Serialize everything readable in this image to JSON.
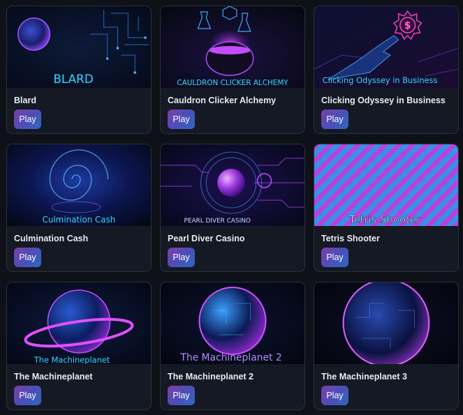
{
  "play_label": "Play",
  "games": [
    {
      "title": "Blard",
      "thumb_text": "BLARD"
    },
    {
      "title": "Cauldron Clicker Alchemy",
      "thumb_text": "CAULDRON CLICKER ALCHEMY"
    },
    {
      "title": "Clicking Odyssey in Business",
      "thumb_text": "Clicking Odyssey in Business"
    },
    {
      "title": "Culmination Cash",
      "thumb_text": "Culmination Cash"
    },
    {
      "title": "Pearl Diver Casino",
      "thumb_text": "PEARL DIVER CASINO"
    },
    {
      "title": "Tetris Shooter",
      "thumb_text": "Tetris Shooter"
    },
    {
      "title": "The Machineplanet",
      "thumb_text": "The Machineplanet"
    },
    {
      "title": "The Machineplanet 2",
      "thumb_text": "The Machineplanet 2"
    },
    {
      "title": "The Machineplanet 3",
      "thumb_text": ""
    }
  ]
}
